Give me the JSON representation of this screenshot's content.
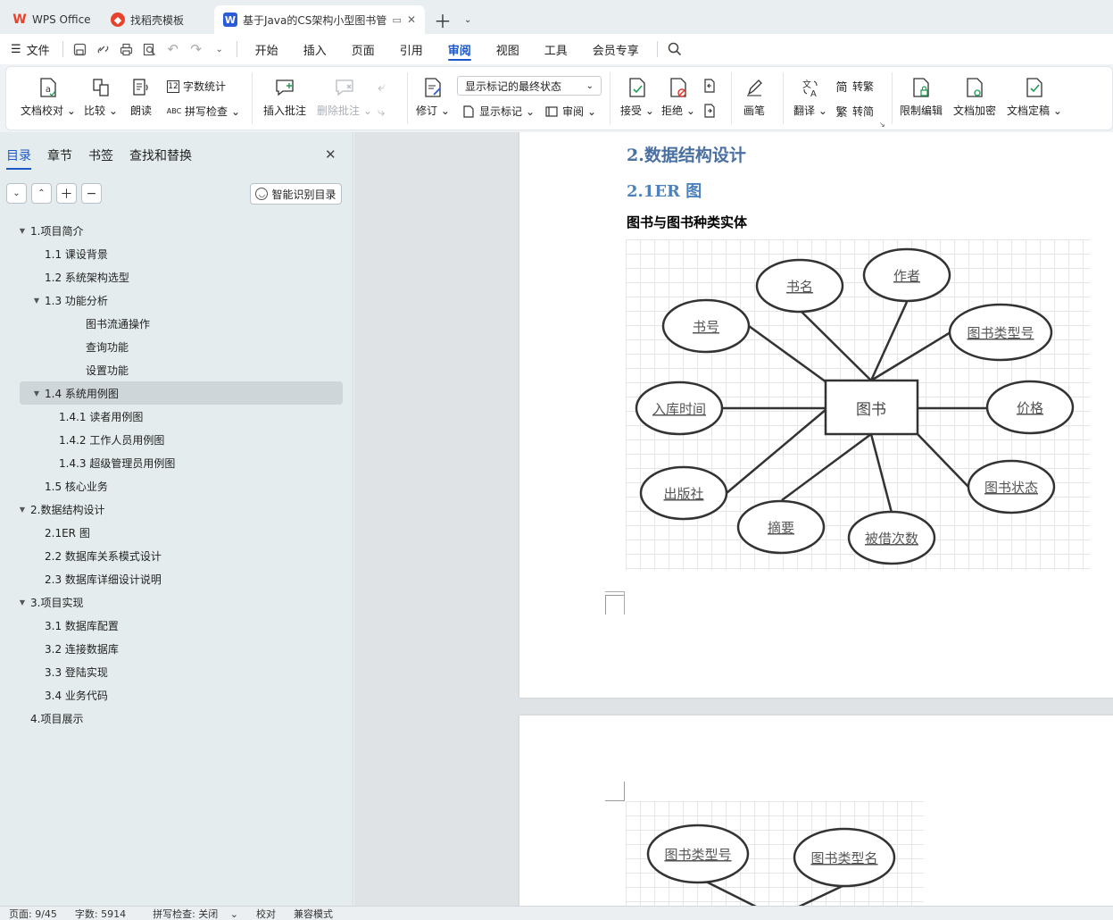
{
  "tabs": [
    {
      "label": "WPS Office",
      "icon": "wps-logo-icon",
      "color": "#e8412c"
    },
    {
      "label": "找稻壳模板",
      "icon": "docer-logo-icon",
      "color": "#e8412c"
    },
    {
      "label": "基于Java的CS架构小型图书管",
      "icon": "word-doc-icon",
      "color": "#2b5bd7"
    }
  ],
  "menu": {
    "file": "文件",
    "items": [
      "开始",
      "插入",
      "页面",
      "引用",
      "审阅",
      "视图",
      "工具",
      "会员专享"
    ],
    "active": "审阅"
  },
  "ribbon": {
    "doc_proof": "文档校对",
    "compare": "比较",
    "read_aloud": "朗读",
    "word_count": "字数统计",
    "spell_check": "拼写检查",
    "insert_comment": "插入批注",
    "delete_comment": "删除批注",
    "track_changes": "修订",
    "markup_select": "显示标记的最终状态",
    "show_markup": "显示标记",
    "review": "审阅",
    "accept": "接受",
    "reject": "拒绝",
    "pen": "画笔",
    "translate": "翻译",
    "to_traditional": "转繁",
    "to_simplified": "转简",
    "restrict_edit": "限制编辑",
    "encrypt": "文档加密",
    "finalize": "文档定稿"
  },
  "sidebar": {
    "tabs": [
      "目录",
      "章节",
      "书签",
      "查找和替换"
    ],
    "smart_toc": "智能识别目录",
    "toc": [
      {
        "label": "1.项目简介",
        "level": 0,
        "arrow": true
      },
      {
        "label": "1.1 课设背景",
        "level": 1
      },
      {
        "label": "1.2 系统架构选型",
        "level": 1
      },
      {
        "label": "1.3 功能分析",
        "level": 1,
        "arrow": true
      },
      {
        "label": "图书流通操作",
        "level": 3
      },
      {
        "label": "查询功能",
        "level": 3
      },
      {
        "label": "设置功能",
        "level": 3
      },
      {
        "label": "1.4 系统用例图",
        "level": 1,
        "arrow": true,
        "selected": true
      },
      {
        "label": "1.4.1 读者用例图",
        "level": 2
      },
      {
        "label": "1.4.2 工作人员用例图",
        "level": 2
      },
      {
        "label": "1.4.3 超级管理员用例图",
        "level": 2
      },
      {
        "label": "1.5 核心业务",
        "level": 1
      },
      {
        "label": "2.数据结构设计",
        "level": 0,
        "arrow": true
      },
      {
        "label": "2.1ER 图",
        "level": 1
      },
      {
        "label": "2.2 数据库关系模式设计",
        "level": 1
      },
      {
        "label": "2.3 数据库详细设计说明",
        "level": 1
      },
      {
        "label": "3.项目实现",
        "level": 0,
        "arrow": true
      },
      {
        "label": "3.1 数据库配置",
        "level": 1
      },
      {
        "label": "3.2 连接数据库",
        "level": 1
      },
      {
        "label": "3.3 登陆实现",
        "level": 1
      },
      {
        "label": "3.4 业务代码",
        "level": 1
      },
      {
        "label": "4.项目展示",
        "level": 0
      }
    ]
  },
  "document": {
    "heading1": "2.数据结构设计",
    "heading2": "2.1ER 图",
    "body": "图书与图书种类实体",
    "er1": {
      "entity": "图书",
      "attributes": [
        "书名",
        "作者",
        "书号",
        "图书类型号",
        "入库时间",
        "价格",
        "出版社",
        "图书状态",
        "摘要",
        "被借次数"
      ]
    },
    "er2": {
      "attributes": [
        "图书类型号",
        "图书类型名"
      ]
    }
  },
  "status": {
    "page": "页面: 9/45",
    "words": "字数: 5914",
    "spell": "拼写检查: 关闭",
    "proof": "校对",
    "compat": "兼容模式"
  }
}
